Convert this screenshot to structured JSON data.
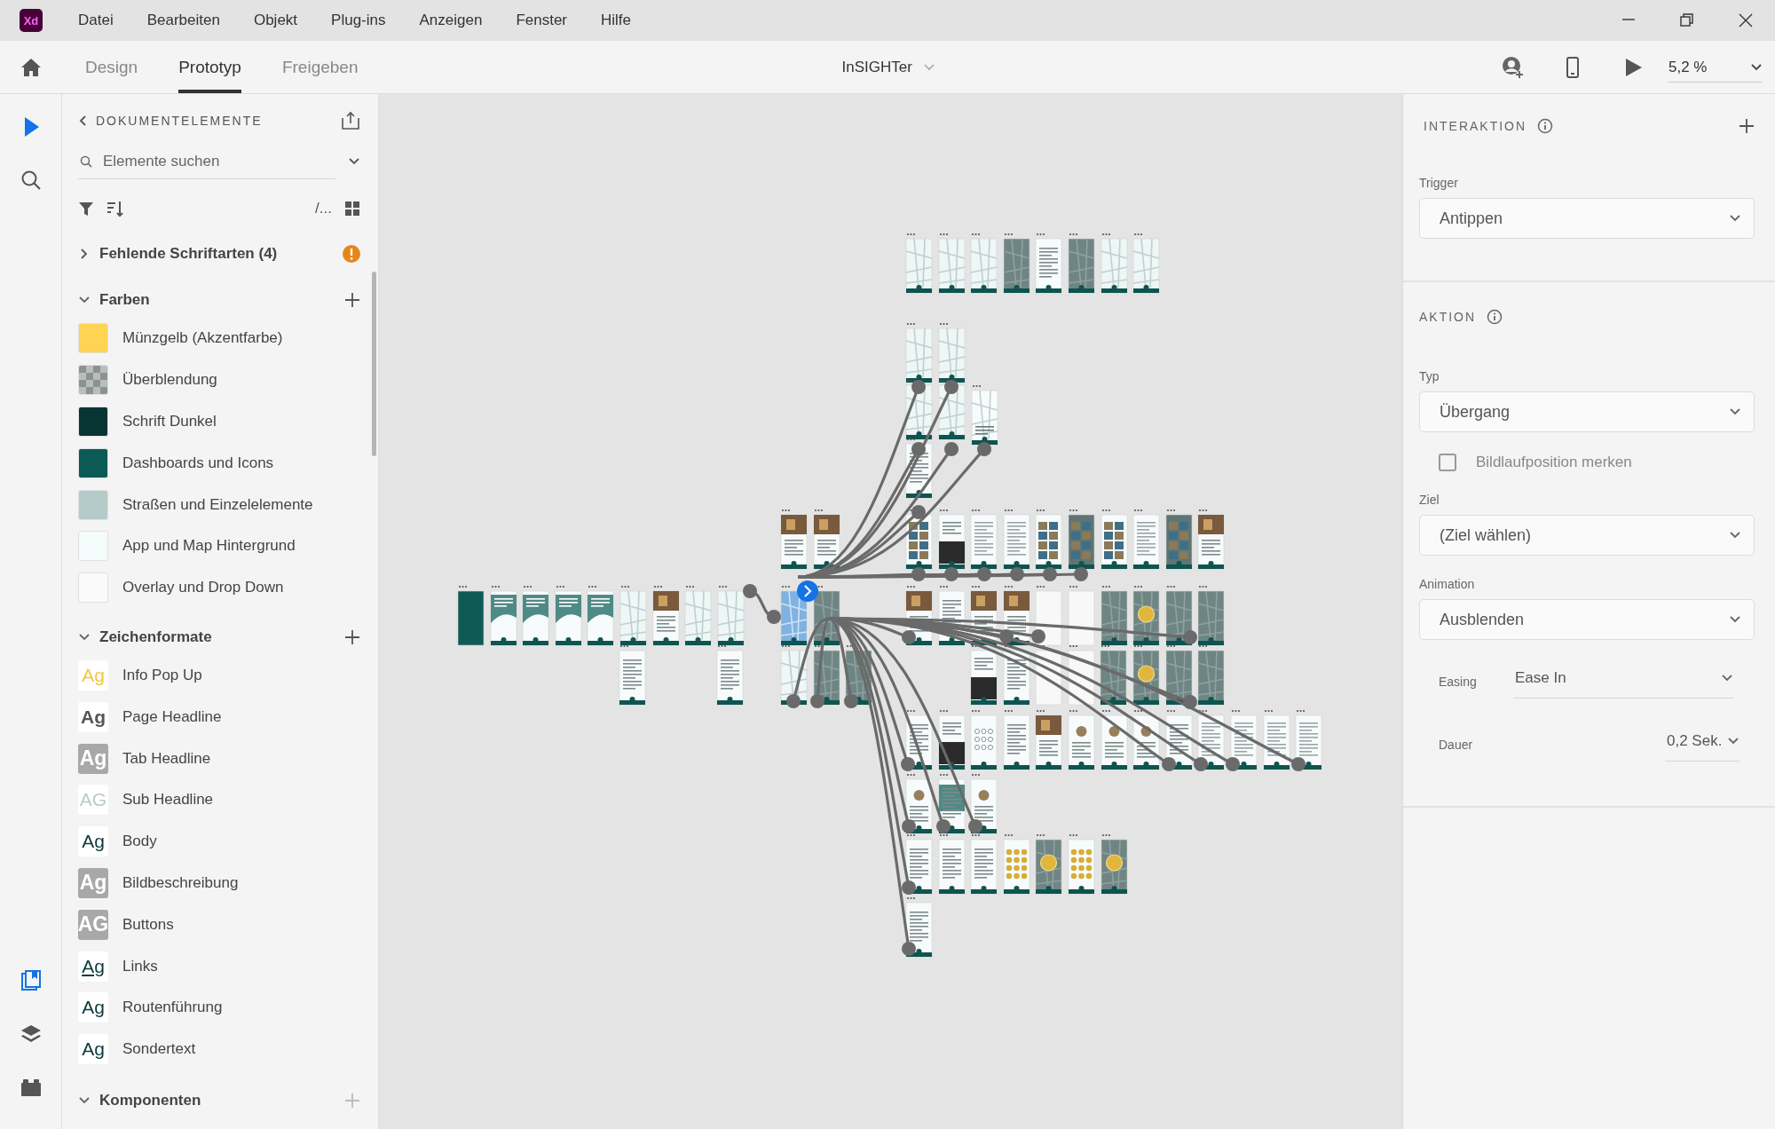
{
  "app": {
    "logo": "Xd"
  },
  "menu": [
    "Datei",
    "Bearbeiten",
    "Objekt",
    "Plug-ins",
    "Anzeigen",
    "Fenster",
    "Hilfe"
  ],
  "toolbar": {
    "tabs": [
      {
        "label": "Design",
        "selected": false
      },
      {
        "label": "Prototyp",
        "selected": true
      },
      {
        "label": "Freigeben",
        "selected": false
      }
    ],
    "document_title": "InSIGHTer",
    "zoom": "5,2 %"
  },
  "rail": {
    "tools": [
      {
        "kind": "select",
        "selected": true
      },
      {
        "kind": "search",
        "selected": false
      }
    ],
    "panels": [
      {
        "kind": "assets",
        "selected": true
      },
      {
        "kind": "layers",
        "selected": false
      },
      {
        "kind": "plugins",
        "selected": false
      }
    ]
  },
  "assets_panel": {
    "title": "DOKUMENTELEMENTE",
    "search": {
      "placeholder": "Elemente suchen"
    },
    "path_label": "/...",
    "missing_fonts": {
      "label": "Fehlende Schriftarten (4)",
      "expanded": false
    },
    "colors": {
      "title": "Farben",
      "expanded": true,
      "items": [
        {
          "name": "Münzgelb (Akzentfarbe)",
          "kind": "solid",
          "color": "#ffd452"
        },
        {
          "name": "Überblendung",
          "kind": "checker",
          "color": "#8c9291"
        },
        {
          "name": "Schrift Dunkel",
          "kind": "solid",
          "color": "#083433"
        },
        {
          "name": "Dashboards und Icons",
          "kind": "solid",
          "color": "#0c5a56"
        },
        {
          "name": "Straßen und Einzelelemente",
          "kind": "solid",
          "color": "#b5cbca"
        },
        {
          "name": "App und Map Hintergrund",
          "kind": "solid",
          "color": "#f4fbfb"
        },
        {
          "name": "Overlay und Drop Down",
          "kind": "solid",
          "color": "#fafafa"
        }
      ]
    },
    "character_styles": {
      "title": "Zeichenformate",
      "expanded": true,
      "items": [
        {
          "name": "Info Pop Up",
          "sample": "Ag",
          "kind": "plain",
          "color": "#f5c53c"
        },
        {
          "name": "Page Headline",
          "sample": "Ag",
          "kind": "bold",
          "color": "#555555"
        },
        {
          "name": "Tab Headline",
          "sample": "Ag",
          "kind": "inverse",
          "color": "#a8a8a8"
        },
        {
          "name": "Sub Headline",
          "sample": "AG",
          "kind": "plain",
          "color": "#b7cbc9"
        },
        {
          "name": "Body",
          "sample": "Ag",
          "kind": "plain",
          "color": "#0d3b3a"
        },
        {
          "name": "Bildbeschreibung",
          "sample": "Ag",
          "kind": "inverse",
          "color": "#a8a8a8"
        },
        {
          "name": "Buttons",
          "sample": "AG",
          "kind": "inverse-bold",
          "color": "#a8a8a8"
        },
        {
          "name": "Links",
          "sample": "Ag",
          "kind": "underline",
          "color": "#0d3b3a"
        },
        {
          "name": "Routenführung",
          "sample": "Ag",
          "kind": "plain",
          "color": "#0d3b3a"
        },
        {
          "name": "Sondertext",
          "sample": "Ag",
          "kind": "plain",
          "color": "#0d3b3a"
        }
      ]
    },
    "components": {
      "title": "Komponenten",
      "expanded": true,
      "add_enabled": false
    }
  },
  "interaction_panel": {
    "title": "INTERAKTION",
    "trigger": {
      "label": "Trigger",
      "value": "Antippen"
    },
    "action_title": "AKTION",
    "type": {
      "label": "Typ",
      "value": "Übergang"
    },
    "scroll_checkbox": {
      "label": "Bildlaufposition merken",
      "checked": false
    },
    "target": {
      "label": "Ziel",
      "value": "(Ziel wählen)"
    },
    "animation": {
      "label": "Animation",
      "value": "Ausblenden"
    },
    "easing": {
      "label": "Easing",
      "value": "Ease In"
    },
    "duration": {
      "label": "Dauer",
      "value": "0,2 Sek."
    }
  }
}
